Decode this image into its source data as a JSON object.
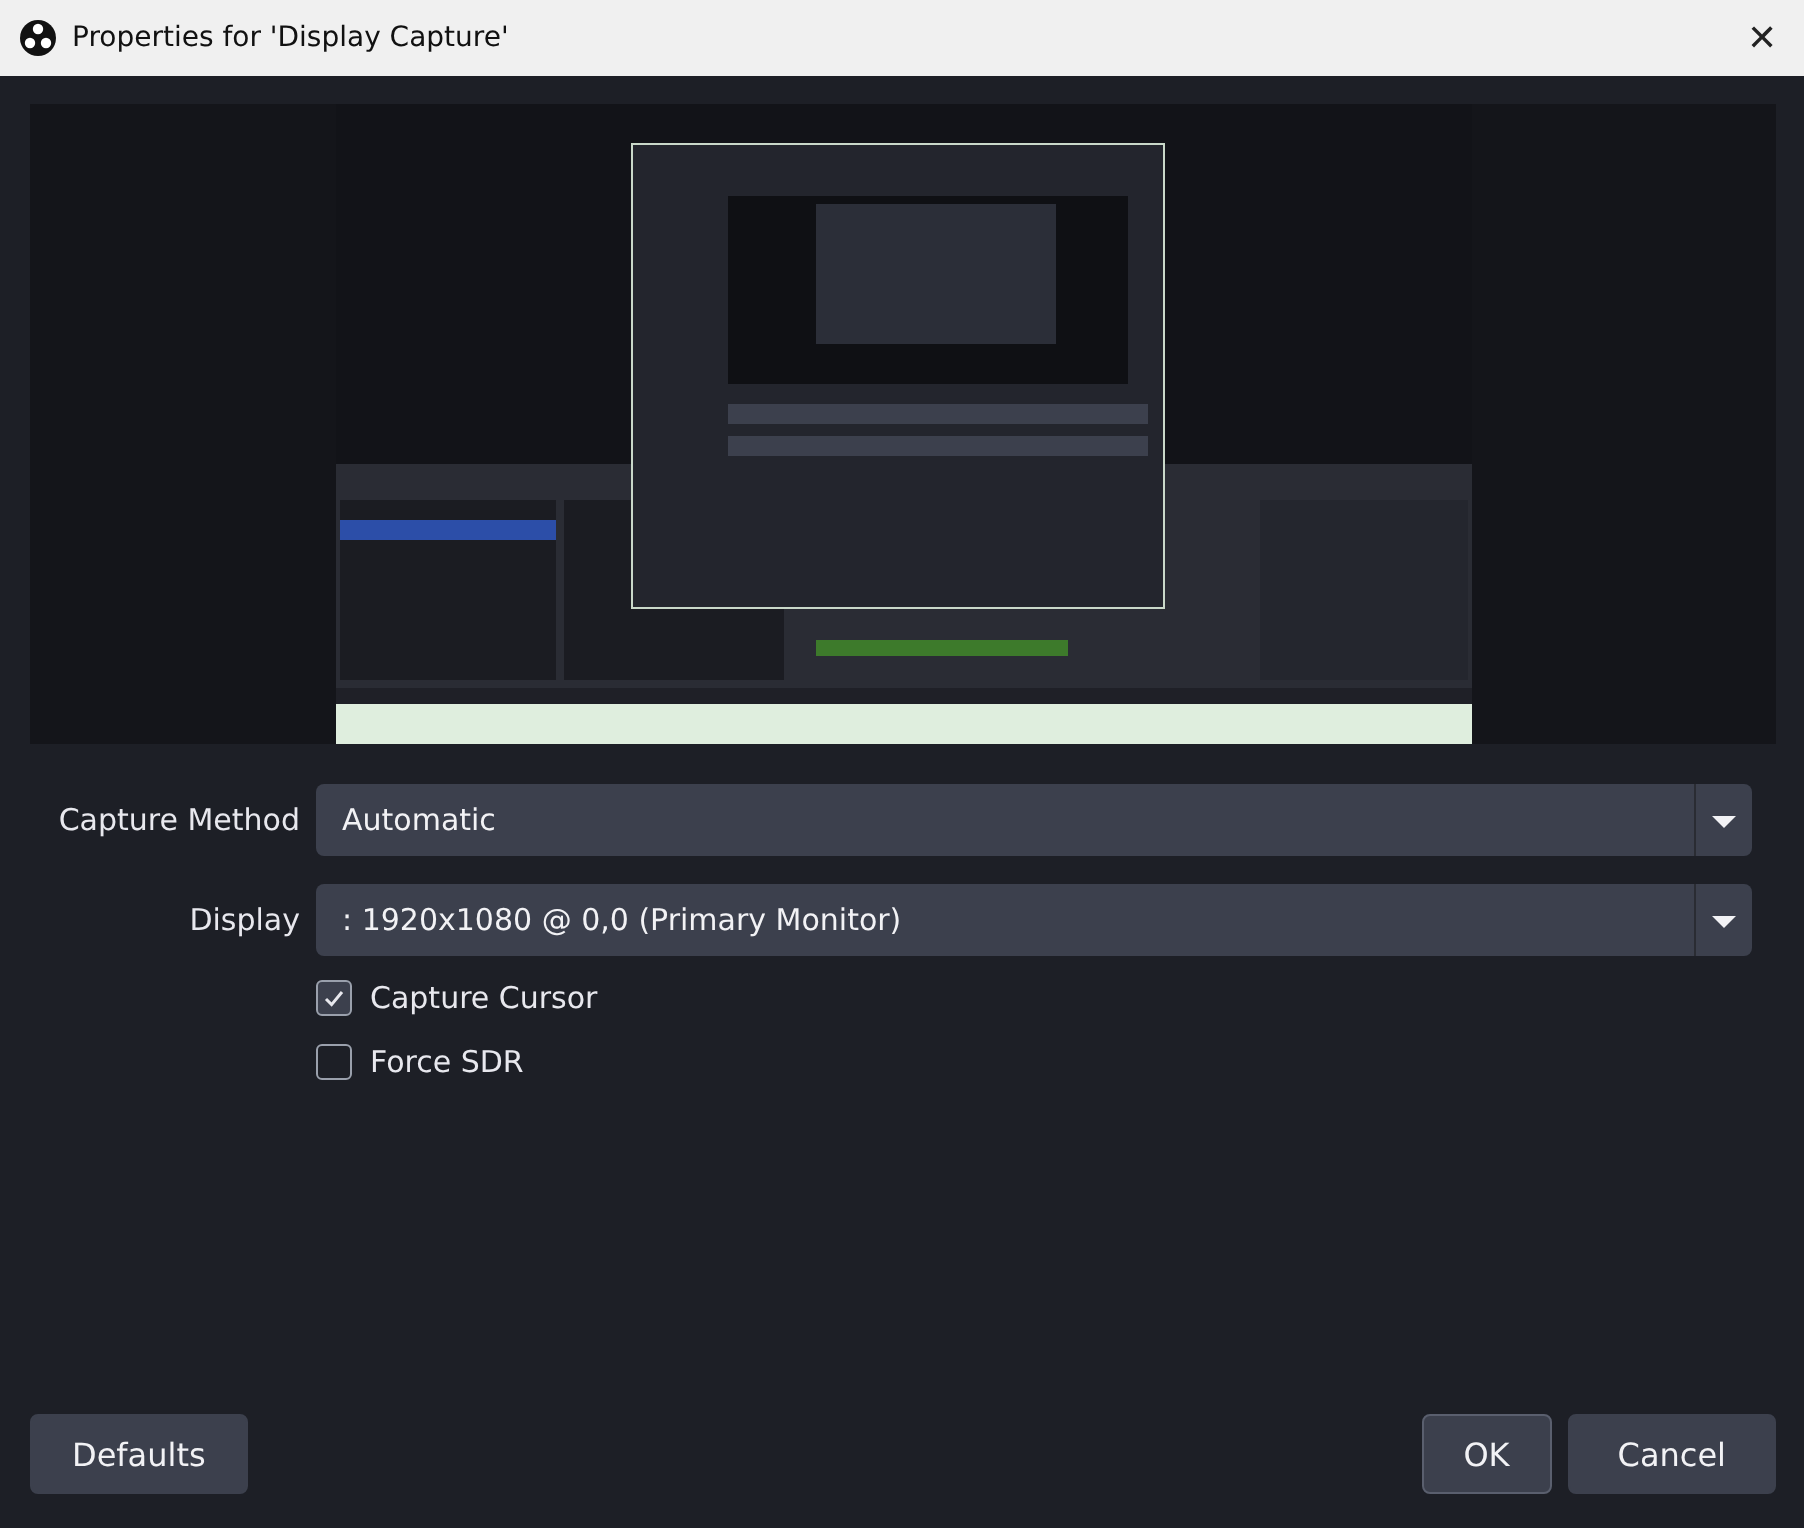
{
  "window": {
    "title": "Properties for 'Display Capture'",
    "close": "✕"
  },
  "fields": [
    {
      "label": "Capture Method",
      "value": "Automatic"
    },
    {
      "label": "Display",
      "value": ": 1920x1080 @ 0,0 (Primary Monitor)"
    }
  ],
  "checkboxes": [
    {
      "label": "Capture Cursor",
      "checked": true
    },
    {
      "label": "Force SDR",
      "checked": false
    }
  ],
  "buttons": {
    "defaults": "Defaults",
    "ok": "OK",
    "cancel": "Cancel"
  }
}
